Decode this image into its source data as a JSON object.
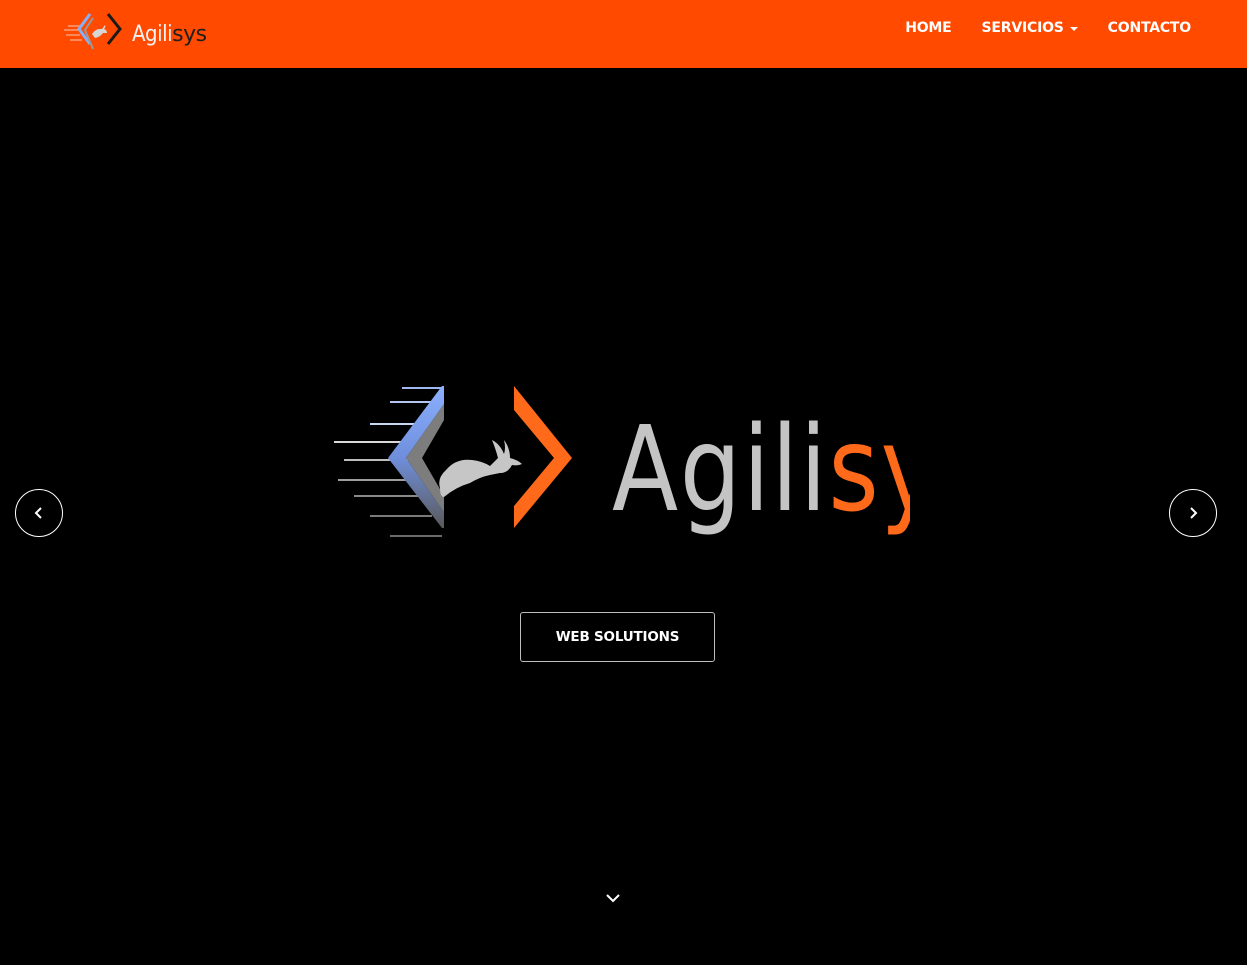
{
  "header": {
    "brand_name": "Agilisys",
    "brand_icon": "agilisys-logo-icon",
    "background_color": "#ff4a00"
  },
  "nav": {
    "items": [
      {
        "label": "HOME",
        "has_dropdown": false
      },
      {
        "label": "SERVICIOS",
        "has_dropdown": true
      },
      {
        "label": "CONTACTO",
        "has_dropdown": false
      }
    ]
  },
  "hero": {
    "logo_text_grey": "Agili",
    "logo_text_orange": "sys",
    "cta_label": "WEB SOLUTIONS",
    "prev_icon": "chevron-left-icon",
    "next_icon": "chevron-right-icon",
    "scroll_icon": "chevron-down-icon",
    "colors": {
      "background": "#000000",
      "accent_orange": "#ff6a1a",
      "logo_grey": "#c4c4c4",
      "logo_blue": "#7da2f2"
    }
  }
}
